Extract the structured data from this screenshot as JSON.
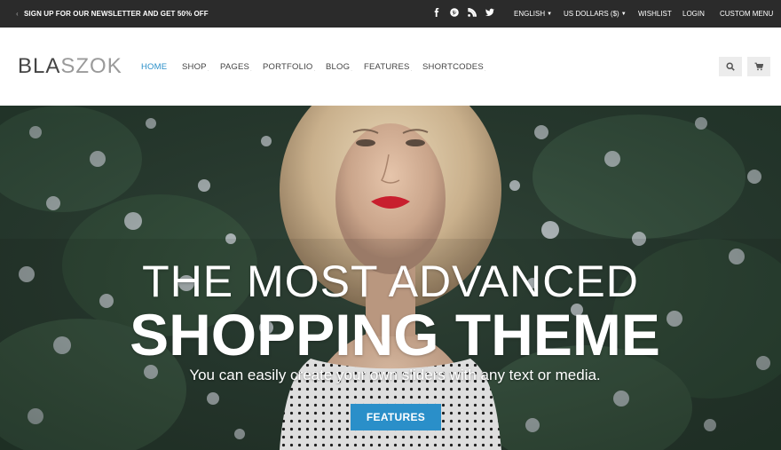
{
  "topbar": {
    "promo": "SIGN UP FOR OUR NEWSLETTER AND GET 50% OFF",
    "social_icons": [
      "facebook-icon",
      "pinterest-icon",
      "rss-icon",
      "twitter-icon"
    ],
    "language": "ENGLISH",
    "currency": "US DOLLARS ($)",
    "wishlist": "WISHLIST",
    "login": "LOGIN",
    "custom_menu": "CUSTOM MENU"
  },
  "header": {
    "logo_part1": "BLA",
    "logo_part2": "SZOK",
    "nav": [
      "HOME",
      "SHOP",
      "PAGES",
      "PORTFOLIO",
      "BLOG",
      "FEATURES",
      "SHORTCODES"
    ],
    "active_nav": "HOME",
    "icons": [
      "search-icon",
      "cart-icon"
    ]
  },
  "hero": {
    "title_line1": "THE MOST ADVANCED",
    "title_line2": "SHOPPING THEME",
    "subtitle": "You can easily create your own sliders with any text or media.",
    "button_label": "FEATURES"
  },
  "colors": {
    "accent": "#2a8fc9",
    "topbar_bg": "#2b2b2b",
    "header_bg": "#ffffff"
  }
}
